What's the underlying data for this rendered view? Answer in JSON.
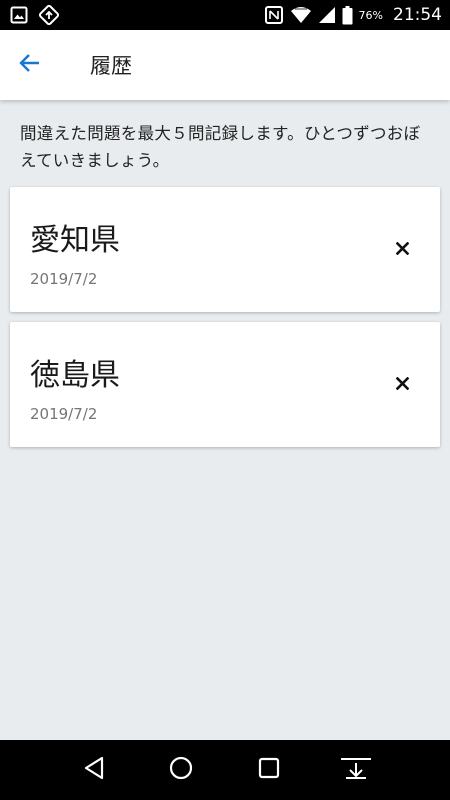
{
  "status_bar": {
    "battery_percent": "76%",
    "time": "21:54",
    "icons": [
      "image-icon",
      "sync-app-icon",
      "nfc-icon",
      "wifi-icon",
      "signal-icon",
      "battery-icon"
    ]
  },
  "app_bar": {
    "title": "履歴",
    "back_icon": "arrow-back-icon",
    "accent_color": "#1976d2"
  },
  "description": "間違えた問題を最大５問記録します。ひとつずつおぼえていきましょう。",
  "history": [
    {
      "name": "愛知県",
      "date": "2019/7/2",
      "action_icon": "close-icon"
    },
    {
      "name": "徳島県",
      "date": "2019/7/2",
      "action_icon": "close-icon"
    }
  ],
  "nav_bar": {
    "buttons": [
      "back-triangle-icon",
      "home-circle-icon",
      "recents-square-icon",
      "hide-bar-icon"
    ]
  }
}
